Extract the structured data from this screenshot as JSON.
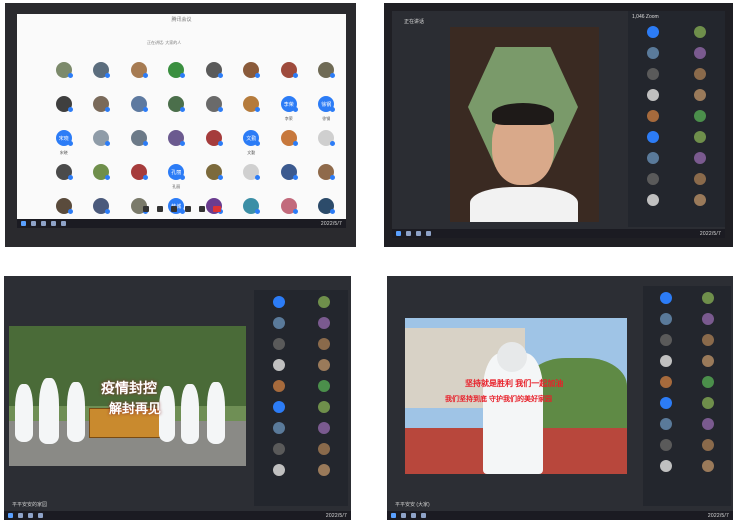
{
  "photo1": {
    "window_title": "腾讯会议",
    "header_label": "正在讲话: 大家的人",
    "participants": [
      {
        "name": "",
        "color": "#7c8a6b"
      },
      {
        "name": "",
        "color": "#5b6d7d"
      },
      {
        "name": "",
        "color": "#a67b52"
      },
      {
        "name": "",
        "color": "#3a8f3f"
      },
      {
        "name": "",
        "color": "#5a5a5a"
      },
      {
        "name": "",
        "color": "#8a5a3a"
      },
      {
        "name": "",
        "color": "#9e4b3c"
      },
      {
        "name": "",
        "color": "#6f6a55"
      },
      {
        "name": "",
        "color": "#3f3f3f"
      },
      {
        "name": "",
        "color": "#7a6a5a"
      },
      {
        "name": "",
        "color": "#5e7aa0"
      },
      {
        "name": "",
        "color": "#4b6f4b"
      },
      {
        "name": "",
        "color": "#6a6a6a"
      },
      {
        "name": "",
        "color": "#b57b3c"
      },
      {
        "name": "李荣",
        "color": "#2c7cf6",
        "text": "李荣"
      },
      {
        "name": "徐钢",
        "color": "#2c7cf6",
        "text": "徐钢"
      },
      {
        "name": "宋晓",
        "color": "#2c7cf6",
        "text": "宋晓"
      },
      {
        "name": "",
        "color": "#8f9ca8"
      },
      {
        "name": "",
        "color": "#6c7a88"
      },
      {
        "name": "",
        "color": "#6b5a8f"
      },
      {
        "name": "",
        "color": "#a53c3c"
      },
      {
        "name": "文勤",
        "color": "#2c7cf6",
        "text": "文勤"
      },
      {
        "name": "",
        "color": "#c7783c"
      },
      {
        "name": "",
        "color": "#cfcfcf"
      },
      {
        "name": "",
        "color": "#4b4b4b"
      },
      {
        "name": "",
        "color": "#6f8f4b"
      },
      {
        "name": "",
        "color": "#a63c3c"
      },
      {
        "name": "孔丽",
        "color": "#2c7cf6",
        "text": "孔丽"
      },
      {
        "name": "",
        "color": "#7c6a3c"
      },
      {
        "name": "",
        "color": "#d0d0d0"
      },
      {
        "name": "",
        "color": "#3c5a8f"
      },
      {
        "name": "",
        "color": "#8f6a4b"
      },
      {
        "name": "",
        "color": "#5a4b3c"
      },
      {
        "name": "",
        "color": "#4b5a7c"
      },
      {
        "name": "",
        "color": "#7a7a6a"
      },
      {
        "name": "韩城",
        "color": "#2c7cf6",
        "text": "韩城"
      },
      {
        "name": "",
        "color": "#6a3c8f"
      },
      {
        "name": "",
        "color": "#3c8fa6"
      },
      {
        "name": "",
        "color": "#c26a7c"
      },
      {
        "name": "",
        "color": "#2c4b6a"
      }
    ],
    "clock": "2022/5/7"
  },
  "photo2": {
    "speaker_label": "正在讲话",
    "sidebar_header": "1,046 Zoom",
    "clock": "2022/5/7"
  },
  "photo3": {
    "banner_line1": "疫情封控",
    "banner_line2": "解封再见",
    "footer": "平平安安的家园",
    "clock": "2022/5/7"
  },
  "photo4": {
    "caption_line1": "坚持就是胜利 我们一起加油",
    "caption_line2": "我们坚持到底 守护我们的美好家园",
    "footer": "平平安安 (大家)",
    "clock": "2022/5/7"
  }
}
